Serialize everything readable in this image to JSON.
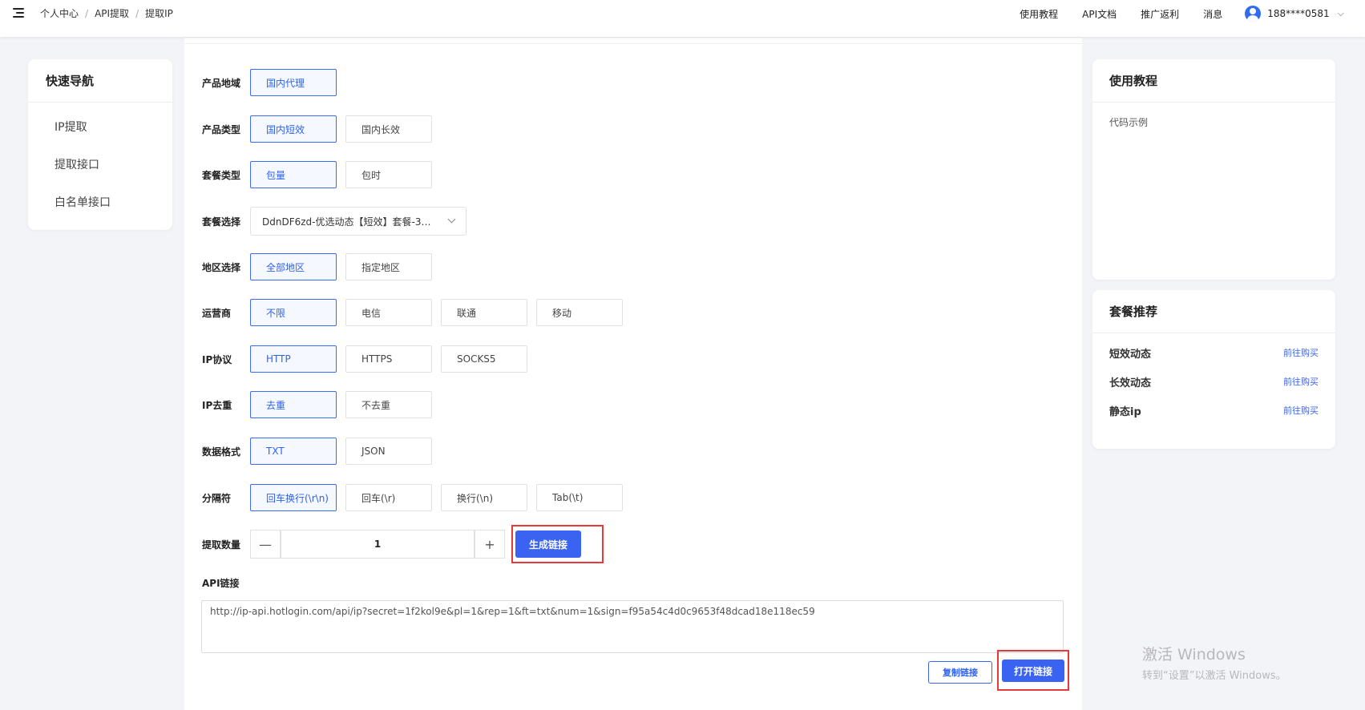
{
  "header": {
    "breadcrumb": [
      "个人中心",
      "API提取",
      "提取IP"
    ],
    "links": [
      "使用教程",
      "API文档",
      "推广返利",
      "消息"
    ],
    "user": "188****0581"
  },
  "leftnav": {
    "title": "快速导航",
    "items": [
      "IP提取",
      "提取接口",
      "白名单接口"
    ]
  },
  "form": {
    "region": {
      "label": "产品地域",
      "options": [
        "国内代理"
      ],
      "selected": "国内代理"
    },
    "product_type": {
      "label": "产品类型",
      "options": [
        "国内短效",
        "国内长效"
      ],
      "selected": "国内短效"
    },
    "plan_type": {
      "label": "套餐类型",
      "options": [
        "包量",
        "包时"
      ],
      "selected": "包量"
    },
    "plan_select": {
      "label": "套餐选择",
      "value": "DdnDF6zd-优选动态【短效】套餐-3…"
    },
    "area": {
      "label": "地区选择",
      "options": [
        "全部地区",
        "指定地区"
      ],
      "selected": "全部地区"
    },
    "carrier": {
      "label": "运营商",
      "options": [
        "不限",
        "电信",
        "联通",
        "移动"
      ],
      "selected": "不限"
    },
    "protocol": {
      "label": "IP协议",
      "options": [
        "HTTP",
        "HTTPS",
        "SOCKS5"
      ],
      "selected": "HTTP"
    },
    "dedup": {
      "label": "IP去重",
      "options": [
        "去重",
        "不去重"
      ],
      "selected": "去重"
    },
    "format": {
      "label": "数据格式",
      "options": [
        "TXT",
        "JSON"
      ],
      "selected": "TXT"
    },
    "separator": {
      "label": "分隔符",
      "options": [
        "回车换行(\\r\\n)",
        "回车(\\r)",
        "换行(\\n)",
        "Tab(\\t)"
      ],
      "selected": "回车换行(\\r\\n)"
    },
    "quantity": {
      "label": "提取数量",
      "minus": "—",
      "value": "1",
      "plus": "+",
      "generate": "生成链接"
    }
  },
  "api": {
    "label": "API链接",
    "url": "http://ip-api.hotlogin.com/api/ip?secret=1f2kol9e&pl=1&rep=1&ft=txt&num=1&sign=f95a54c4d0c9653f48dcad18e118ec59",
    "copy": "复制链接",
    "open": "打开链接"
  },
  "tutorial": {
    "title": "使用教程",
    "code_example": "代码示例"
  },
  "packages": {
    "title": "套餐推荐",
    "items": [
      {
        "name": "短效动态",
        "link": "前往购买"
      },
      {
        "name": "长效动态",
        "link": "前往购买"
      },
      {
        "name": "静态ip",
        "link": "前往购买"
      }
    ]
  },
  "watermark": {
    "line1": "激活 Windows",
    "line2": "转到“设置”以激活 Windows。"
  },
  "colors": {
    "accent": "#3a63f2",
    "highlight_box": "#e8393a"
  }
}
